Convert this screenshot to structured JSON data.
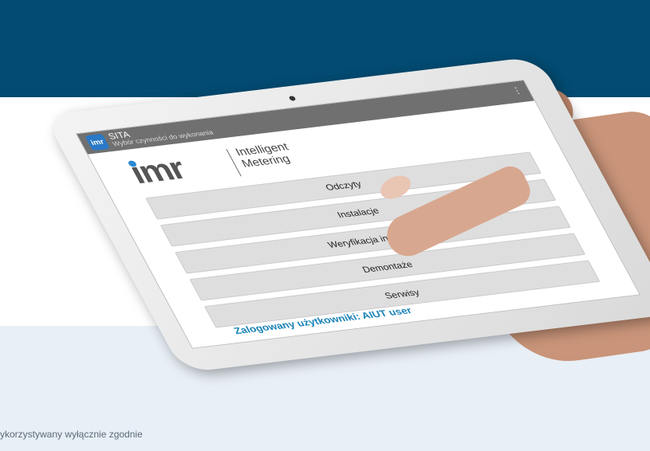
{
  "background": {
    "footer_text": "ykorzystywany wyłącznie zgodnie",
    "colors": {
      "top_band": "#034b72",
      "bottom_band": "#e8eff6"
    }
  },
  "app": {
    "icon_label": "imr",
    "title": "SITA",
    "subtitle": "Wybór czynności do wykonania",
    "menu_icon": "overflow-menu-icon"
  },
  "logo": {
    "mark": "imr",
    "line1": "Intelligent",
    "line2": "Metering"
  },
  "menu": {
    "items": [
      {
        "label": "Odczyty"
      },
      {
        "label": "Instalacje"
      },
      {
        "label": "Weryfikacja instalacji"
      },
      {
        "label": "Demontaże"
      },
      {
        "label": "Serwisy"
      }
    ]
  },
  "user": {
    "label": "Zalogowany użytkowniki: AIUT user"
  }
}
